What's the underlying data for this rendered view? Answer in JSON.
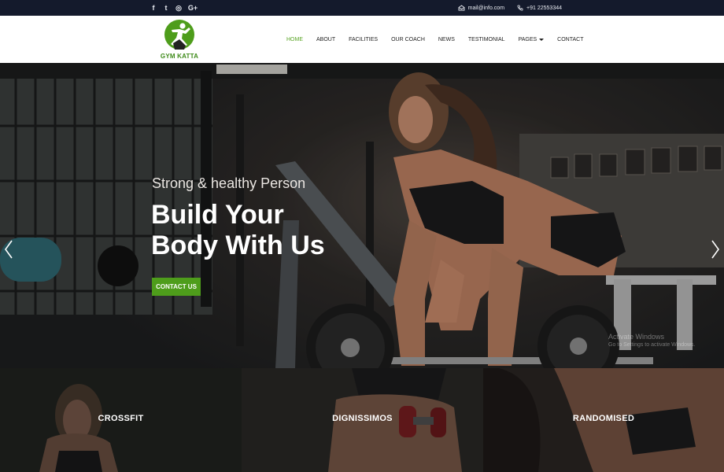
{
  "topbar": {
    "social": [
      {
        "icon": "facebook-icon",
        "glyph": "f"
      },
      {
        "icon": "twitter-icon",
        "glyph": "t"
      },
      {
        "icon": "instagram-icon",
        "glyph": "◎"
      },
      {
        "icon": "google-plus-icon",
        "glyph": "G+"
      }
    ],
    "email": "mail@info.com",
    "phone": "+91 22553344"
  },
  "brand": {
    "name": "GYM KATTA",
    "accent": "#4e9d1b"
  },
  "nav": {
    "items": [
      "HOME",
      "ABOUT",
      "FACILITIES",
      "OUR COACH",
      "NEWS",
      "TESTIMONIAL",
      "PAGES",
      "CONTACT"
    ],
    "active": "HOME"
  },
  "hero": {
    "subtitle": "Strong & healthy Person",
    "title_line1": "Build Your",
    "title_line2": "Body With Us",
    "cta": "CONTACT US"
  },
  "watermark": {
    "line1": "Activate Windows",
    "line2": "Go to Settings to activate Windows."
  },
  "tiles": [
    "CROSSFIT",
    "DIGNISSIMOS",
    "RANDOMISED"
  ]
}
